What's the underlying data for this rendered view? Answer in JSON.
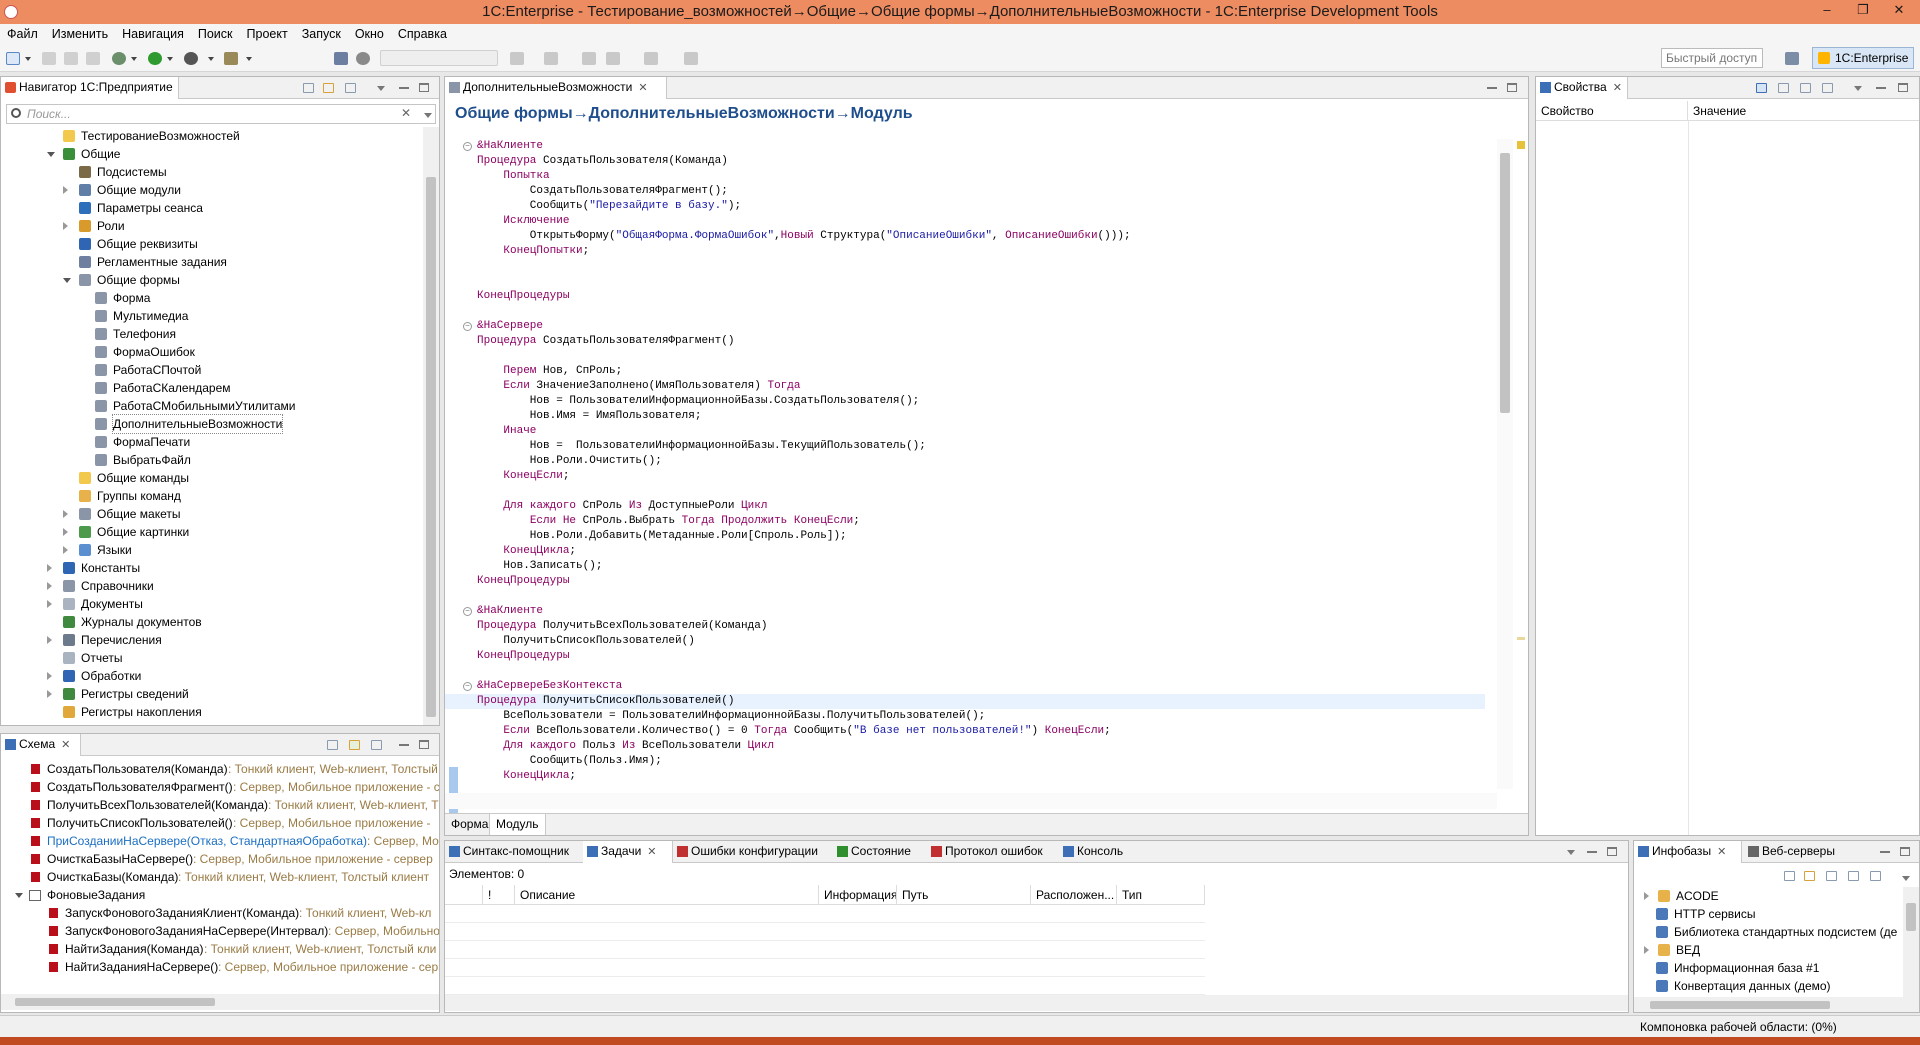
{
  "window": {
    "title": "1C:Enterprise - Тестирование_возможностей→Общие→Общие формы→ДополнительныеВозможности - 1C:Enterprise Development Tools",
    "minimize": "–",
    "restore": "❐",
    "close": "✕"
  },
  "menu": [
    "Файл",
    "Изменить",
    "Навигация",
    "Поиск",
    "Проект",
    "Запуск",
    "Окно",
    "Справка"
  ],
  "toolbar": {
    "quick_access": "Быстрый доступ",
    "perspective": "1C:Enterprise"
  },
  "navigator": {
    "tab": "Навигатор 1С:Предприятие",
    "search_placeholder": "Поиск...",
    "clear": "✕",
    "items": [
      {
        "label": "ТестированиеВозможностей",
        "level": 1,
        "arrow": "",
        "icon": "#f2c94c",
        "sel": false
      },
      {
        "label": "Общие",
        "level": 1,
        "arrow": "d",
        "icon": "#3a8f3a",
        "sel": false
      },
      {
        "label": "Подсистемы",
        "level": 2,
        "arrow": "",
        "icon": "#7a6a48",
        "sel": false
      },
      {
        "label": "Общие модули",
        "level": 2,
        "arrow": "r",
        "icon": "#5f7fa6",
        "sel": false
      },
      {
        "label": "Параметры сеанса",
        "level": 2,
        "arrow": "",
        "icon": "#2d6fba",
        "sel": false
      },
      {
        "label": "Роли",
        "level": 2,
        "arrow": "r",
        "icon": "#d89b2b",
        "sel": false
      },
      {
        "label": "Общие реквизиты",
        "level": 2,
        "arrow": "",
        "icon": "#2f66b3",
        "sel": false
      },
      {
        "label": "Регламентные задания",
        "level": 2,
        "arrow": "",
        "icon": "#6e7fa0",
        "sel": false
      },
      {
        "label": "Общие формы",
        "level": 2,
        "arrow": "d",
        "icon": "#8a96a8",
        "sel": false
      },
      {
        "label": "Форма",
        "level": 3,
        "arrow": "",
        "icon": "#8a96a8",
        "sel": false
      },
      {
        "label": "Мультимедиа",
        "level": 3,
        "arrow": "",
        "icon": "#8a96a8",
        "sel": false
      },
      {
        "label": "Телефония",
        "level": 3,
        "arrow": "",
        "icon": "#8a96a8",
        "sel": false
      },
      {
        "label": "ФормаОшибок",
        "level": 3,
        "arrow": "",
        "icon": "#8a96a8",
        "sel": false
      },
      {
        "label": "РаботаСПочтой",
        "level": 3,
        "arrow": "",
        "icon": "#8a96a8",
        "sel": false
      },
      {
        "label": "РаботаСКалендарем",
        "level": 3,
        "arrow": "",
        "icon": "#8a96a8",
        "sel": false
      },
      {
        "label": "РаботаСМобильнымиУтилитами",
        "level": 3,
        "arrow": "",
        "icon": "#8a96a8",
        "sel": false
      },
      {
        "label": "ДополнительныеВозможности",
        "level": 3,
        "arrow": "",
        "icon": "#8a96a8",
        "sel": true
      },
      {
        "label": "ФормаПечати",
        "level": 3,
        "arrow": "",
        "icon": "#8a96a8",
        "sel": false
      },
      {
        "label": "ВыбратьФайл",
        "level": 3,
        "arrow": "",
        "icon": "#8a96a8",
        "sel": false
      },
      {
        "label": "Общие команды",
        "level": 2,
        "arrow": "",
        "icon": "#f2c94c",
        "sel": false
      },
      {
        "label": "Группы команд",
        "level": 2,
        "arrow": "",
        "icon": "#e8b24a",
        "sel": false
      },
      {
        "label": "Общие макеты",
        "level": 2,
        "arrow": "r",
        "icon": "#8a96a8",
        "sel": false
      },
      {
        "label": "Общие картинки",
        "level": 2,
        "arrow": "r",
        "icon": "#4d9a4d",
        "sel": false
      },
      {
        "label": "Языки",
        "level": 2,
        "arrow": "r",
        "icon": "#5b8fd0",
        "sel": false
      },
      {
        "label": "Константы",
        "level": 1,
        "arrow": "r",
        "icon": "#2f66b3",
        "sel": false
      },
      {
        "label": "Справочники",
        "level": 1,
        "arrow": "r",
        "icon": "#8a96a8",
        "sel": false
      },
      {
        "label": "Документы",
        "level": 1,
        "arrow": "r",
        "icon": "#aab3c0",
        "sel": false
      },
      {
        "label": "Журналы документов",
        "level": 1,
        "arrow": "",
        "icon": "#3f8a3f",
        "sel": false
      },
      {
        "label": "Перечисления",
        "level": 1,
        "arrow": "r",
        "icon": "#6c7a8c",
        "sel": false
      },
      {
        "label": "Отчеты",
        "level": 1,
        "arrow": "",
        "icon": "#aab3c0",
        "sel": false
      },
      {
        "label": "Обработки",
        "level": 1,
        "arrow": "r",
        "icon": "#2f66b3",
        "sel": false
      },
      {
        "label": "Регистры сведений",
        "level": 1,
        "arrow": "r",
        "icon": "#3f8a3f",
        "sel": false
      },
      {
        "label": "Регистры накопления",
        "level": 1,
        "arrow": "",
        "icon": "#e0a83a",
        "sel": false
      }
    ]
  },
  "schema": {
    "tab": "Схема",
    "items": [
      {
        "name": "СоздатьПользователя(Команда)",
        "detail": " : Тонкий клиент, Web-клиент, Толстый",
        "level": 1,
        "link": false
      },
      {
        "name": "СоздатьПользователяФрагмент()",
        "detail": " : Сервер, Мобильное приложение - с",
        "level": 1,
        "link": false
      },
      {
        "name": "ПолучитьВсехПользователей(Команда)",
        "detail": " : Тонкий клиент, Web-клиент, Т",
        "level": 1,
        "link": false
      },
      {
        "name": "ПолучитьСписокПользователей()",
        "detail": " : Сервер, Мобильное приложение -",
        "level": 1,
        "link": false
      },
      {
        "name": "ПриСозданииНаСервере(Отказ, СтандартнаяОбработка)",
        "detail": " : Сервер, Моб",
        "level": 1,
        "link": true
      },
      {
        "name": "ОчисткаБазыНаСервере()",
        "detail": " : Сервер, Мобильное приложение - сервер",
        "level": 1,
        "link": false
      },
      {
        "name": "ОчисткаБазы(Команда)",
        "detail": " : Тонкий клиент, Web-клиент, Толстый клиент",
        "level": 1,
        "link": false
      },
      {
        "name": "ФоновыеЗадания",
        "detail": "",
        "level": 0,
        "link": false
      },
      {
        "name": "ЗапускФоновогоЗаданияКлиент(Команда)",
        "detail": " : Тонкий клиент, Web-кл",
        "level": 2,
        "link": false
      },
      {
        "name": "ЗапускФоновогоЗаданияНаСервере(Интервал)",
        "detail": " : Сервер, Мобильно",
        "level": 2,
        "link": false
      },
      {
        "name": "НайтиЗадания(Команда)",
        "detail": " : Тонкий клиент, Web-клиент, Толстый кли",
        "level": 2,
        "link": false
      },
      {
        "name": "НайтиЗаданияНаСервере()",
        "detail": " : Сервер, Мобильное приложение - серв",
        "level": 2,
        "link": false
      }
    ]
  },
  "editor": {
    "tab": "ДополнительныеВозможности",
    "header": "Общие формы→ДополнительныеВозможности→Модуль",
    "bottom_tabs": [
      "Форма",
      "Модуль"
    ],
    "lines": [
      {
        "fold": true,
        "cur": false,
        "s": [
          [
            "pp",
            "&НаКлиенте"
          ]
        ]
      },
      {
        "fold": false,
        "cur": false,
        "s": [
          [
            "kw",
            "Процедура "
          ],
          [
            "pl",
            "СоздатьПользователя(Команда)"
          ]
        ]
      },
      {
        "fold": false,
        "cur": false,
        "s": [
          [
            "pl",
            "    "
          ],
          [
            "kw",
            "Попытка"
          ]
        ]
      },
      {
        "fold": false,
        "cur": false,
        "s": [
          [
            "pl",
            "        СоздатьПользователяФрагмент();"
          ]
        ]
      },
      {
        "fold": false,
        "cur": false,
        "s": [
          [
            "pl",
            "        Сообщить("
          ],
          [
            "str",
            "\"Перезайдите в базу.\""
          ],
          [
            "pl",
            ");"
          ]
        ]
      },
      {
        "fold": false,
        "cur": false,
        "s": [
          [
            "pl",
            "    "
          ],
          [
            "kw",
            "Исключение"
          ]
        ]
      },
      {
        "fold": false,
        "cur": false,
        "s": [
          [
            "pl",
            "        ОткрытьФорму("
          ],
          [
            "str",
            "\"ОбщаяФорма.ФормаОшибок\""
          ],
          [
            "pl",
            ","
          ],
          [
            "kw",
            "Новый "
          ],
          [
            "pl",
            "Структура("
          ],
          [
            "str",
            "\"ОписаниеОшибки\""
          ],
          [
            "pl",
            ", "
          ],
          [
            "kw",
            "ОписаниеОшибки"
          ],
          [
            "pl",
            "()));"
          ]
        ]
      },
      {
        "fold": false,
        "cur": false,
        "s": [
          [
            "pl",
            "    "
          ],
          [
            "kw",
            "КонецПопытки"
          ],
          [
            "pl",
            ";"
          ]
        ]
      },
      {
        "fold": false,
        "cur": false,
        "s": [
          [
            "pl",
            ""
          ]
        ]
      },
      {
        "fold": false,
        "cur": false,
        "s": [
          [
            "pl",
            ""
          ]
        ]
      },
      {
        "fold": false,
        "cur": false,
        "s": [
          [
            "kw",
            "КонецПроцедуры"
          ]
        ]
      },
      {
        "fold": false,
        "cur": false,
        "s": [
          [
            "pl",
            ""
          ]
        ]
      },
      {
        "fold": true,
        "cur": false,
        "s": [
          [
            "pp",
            "&НаСервере"
          ]
        ]
      },
      {
        "fold": false,
        "cur": false,
        "s": [
          [
            "kw",
            "Процедура "
          ],
          [
            "pl",
            "СоздатьПользователяФрагмент()"
          ]
        ]
      },
      {
        "fold": false,
        "cur": false,
        "s": [
          [
            "pl",
            ""
          ]
        ]
      },
      {
        "fold": false,
        "cur": false,
        "s": [
          [
            "pl",
            "    "
          ],
          [
            "kw",
            "Перем "
          ],
          [
            "pl",
            "Нов, СпРоль;"
          ]
        ]
      },
      {
        "fold": false,
        "cur": false,
        "s": [
          [
            "pl",
            "    "
          ],
          [
            "kw",
            "Если "
          ],
          [
            "pl",
            "ЗначениеЗаполнено(ИмяПользователя) "
          ],
          [
            "kw",
            "Тогда"
          ]
        ]
      },
      {
        "fold": false,
        "cur": false,
        "s": [
          [
            "pl",
            "        Нов = ПользователиИнформационнойБазы.СоздатьПользователя();"
          ]
        ]
      },
      {
        "fold": false,
        "cur": false,
        "s": [
          [
            "pl",
            "        Нов.Имя = ИмяПользователя;"
          ]
        ]
      },
      {
        "fold": false,
        "cur": false,
        "s": [
          [
            "pl",
            "    "
          ],
          [
            "kw",
            "Иначе"
          ]
        ]
      },
      {
        "fold": false,
        "cur": false,
        "s": [
          [
            "pl",
            "        Нов =  ПользователиИнформационнойБазы.ТекущийПользователь();"
          ]
        ]
      },
      {
        "fold": false,
        "cur": false,
        "s": [
          [
            "pl",
            "        Нов.Роли.Очистить();"
          ]
        ]
      },
      {
        "fold": false,
        "cur": false,
        "s": [
          [
            "pl",
            "    "
          ],
          [
            "kw",
            "КонецЕсли"
          ],
          [
            "pl",
            ";"
          ]
        ]
      },
      {
        "fold": false,
        "cur": false,
        "s": [
          [
            "pl",
            ""
          ]
        ]
      },
      {
        "fold": false,
        "cur": false,
        "s": [
          [
            "pl",
            "    "
          ],
          [
            "kw",
            "Для каждого "
          ],
          [
            "pl",
            "СпРоль "
          ],
          [
            "kw",
            "Из "
          ],
          [
            "pl",
            "ДоступныеРоли "
          ],
          [
            "kw",
            "Цикл"
          ]
        ]
      },
      {
        "fold": false,
        "cur": false,
        "s": [
          [
            "pl",
            "        "
          ],
          [
            "kw",
            "Если Не "
          ],
          [
            "pl",
            "СпРоль.Выбрать "
          ],
          [
            "kw",
            "Тогда Продолжить КонецЕсли"
          ],
          [
            "pl",
            ";"
          ]
        ]
      },
      {
        "fold": false,
        "cur": false,
        "s": [
          [
            "pl",
            "        Нов.Роли.Добавить(Метаданные.Роли[Спроль.Роль]);"
          ]
        ]
      },
      {
        "fold": false,
        "cur": false,
        "s": [
          [
            "pl",
            "    "
          ],
          [
            "kw",
            "КонецЦикла"
          ],
          [
            "pl",
            ";"
          ]
        ]
      },
      {
        "fold": false,
        "cur": false,
        "s": [
          [
            "pl",
            "    Нов.Записать();"
          ]
        ]
      },
      {
        "fold": false,
        "cur": false,
        "s": [
          [
            "kw",
            "КонецПроцедуры"
          ]
        ]
      },
      {
        "fold": false,
        "cur": false,
        "s": [
          [
            "pl",
            ""
          ]
        ]
      },
      {
        "fold": true,
        "cur": false,
        "s": [
          [
            "pp",
            "&НаКлиенте"
          ]
        ]
      },
      {
        "fold": false,
        "cur": false,
        "s": [
          [
            "kw",
            "Процедура "
          ],
          [
            "pl",
            "ПолучитьВсехПользователей(Команда)"
          ]
        ]
      },
      {
        "fold": false,
        "cur": false,
        "s": [
          [
            "pl",
            "    ПолучитьСписокПользователей()"
          ]
        ]
      },
      {
        "fold": false,
        "cur": false,
        "s": [
          [
            "kw",
            "КонецПроцедуры"
          ]
        ]
      },
      {
        "fold": false,
        "cur": false,
        "s": [
          [
            "pl",
            ""
          ]
        ]
      },
      {
        "fold": true,
        "cur": false,
        "s": [
          [
            "pp",
            "&НаСервереБезКонтекста"
          ]
        ]
      },
      {
        "fold": false,
        "cur": true,
        "s": [
          [
            "kw",
            "Процедура "
          ],
          [
            "pl",
            "ПолучитьСписокПользователей()"
          ]
        ]
      },
      {
        "fold": false,
        "cur": false,
        "s": [
          [
            "pl",
            "    ВсеПользователи = ПользователиИнформационнойБазы.ПолучитьПользователей();"
          ]
        ]
      },
      {
        "fold": false,
        "cur": false,
        "s": [
          [
            "pl",
            "    "
          ],
          [
            "kw",
            "Если "
          ],
          [
            "pl",
            "ВсеПользователи.Количество() = 0 "
          ],
          [
            "kw",
            "Тогда "
          ],
          [
            "pl",
            "Сообщить("
          ],
          [
            "str",
            "\"В базе нет пользователей!\""
          ],
          [
            "pl",
            ") "
          ],
          [
            "kw",
            "КонецЕсли"
          ],
          [
            "pl",
            ";"
          ]
        ]
      },
      {
        "fold": false,
        "cur": false,
        "s": [
          [
            "pl",
            "    "
          ],
          [
            "kw",
            "Для каждого "
          ],
          [
            "pl",
            "Польз "
          ],
          [
            "kw",
            "Из "
          ],
          [
            "pl",
            "ВсеПользователи "
          ],
          [
            "kw",
            "Цикл"
          ]
        ]
      },
      {
        "fold": false,
        "cur": false,
        "s": [
          [
            "pl",
            "        Сообщить(Польз.Имя);"
          ]
        ]
      },
      {
        "fold": false,
        "cur": false,
        "s": [
          [
            "pl",
            "    "
          ],
          [
            "kw",
            "КонецЦикла"
          ],
          [
            "pl",
            ";"
          ]
        ]
      }
    ]
  },
  "properties": {
    "tab": "Свойства",
    "col1": "Свойство",
    "col2": "Значение"
  },
  "tasks": {
    "tabs": [
      {
        "label": "Синтакс-помощник",
        "icon": "#3d6fb6",
        "active": false
      },
      {
        "label": "Задачи",
        "icon": "#3d6fb6",
        "active": true
      },
      {
        "label": "Ошибки конфигурации",
        "icon": "#c03030",
        "active": false
      },
      {
        "label": "Состояние",
        "icon": "#2f8f2f",
        "active": false
      },
      {
        "label": "Протокол ошибок",
        "icon": "#c03030",
        "active": false
      },
      {
        "label": "Консоль",
        "icon": "#3d6fb6",
        "active": false
      }
    ],
    "count_label": "Элементов: 0",
    "columns": [
      "!",
      "Описание",
      "Информация",
      "Путь",
      "Расположен...",
      "Тип"
    ]
  },
  "infobases": {
    "tabs": [
      "Инфобазы",
      "Веб-серверы"
    ],
    "items": [
      {
        "label": "ACODE",
        "arrow": true,
        "icon": "#e8b24a",
        "indent": 0
      },
      {
        "label": "HTTP сервисы",
        "arrow": false,
        "icon": "#4a78b8",
        "indent": 1
      },
      {
        "label": "Библиотека стандартных подсистем (де",
        "arrow": false,
        "icon": "#4a78b8",
        "indent": 1
      },
      {
        "label": "ВЕД",
        "arrow": true,
        "icon": "#e8b24a",
        "indent": 0
      },
      {
        "label": "Информационная база #1",
        "arrow": false,
        "icon": "#4a78b8",
        "indent": 1
      },
      {
        "label": "Конвертация данных (демо)",
        "arrow": false,
        "icon": "#4a78b8",
        "indent": 1
      }
    ]
  },
  "status": {
    "layout_text": "Компоновка рабочей области: (0%)"
  }
}
